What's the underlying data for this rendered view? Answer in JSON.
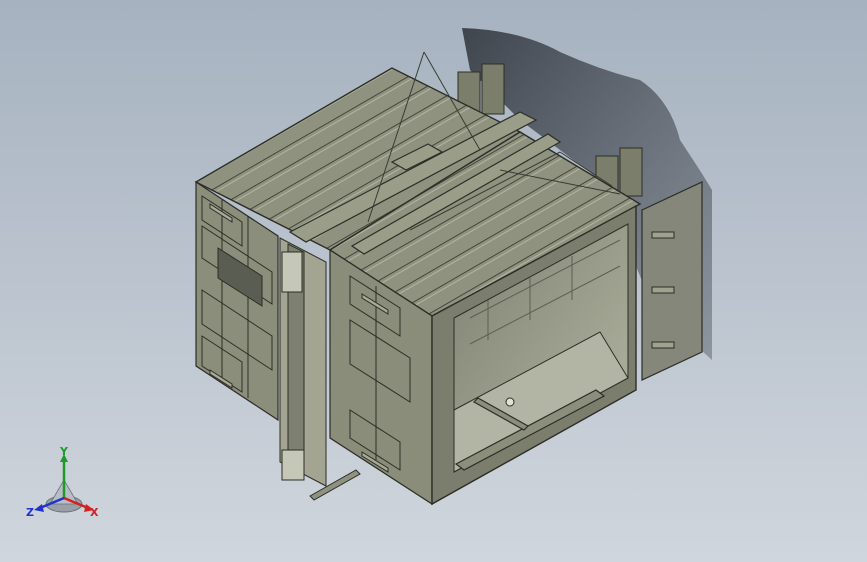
{
  "viewport": {
    "background_top": "#a6b2c0",
    "background_bottom": "#d0d6dd",
    "model_color": "#8e917c",
    "model_edge_color": "#2c2d26"
  },
  "triad": {
    "x_label": "X",
    "y_label": "Y",
    "z_label": "Z",
    "x_color": "#d32020",
    "y_color": "#1e9a28",
    "z_color": "#2233cc"
  }
}
